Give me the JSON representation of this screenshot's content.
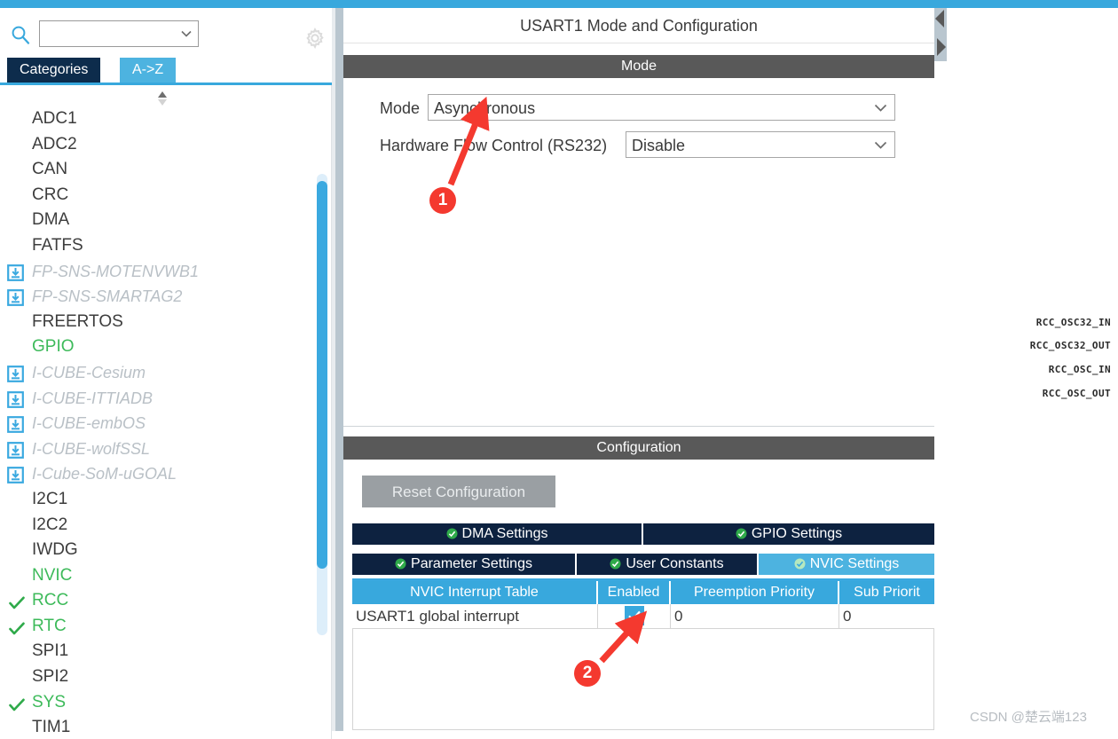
{
  "app": {
    "watermark": "CSDN @楚云端123"
  },
  "sidebar": {
    "search": {
      "value": "",
      "placeholder": ""
    },
    "tabs": [
      {
        "label": "Categories",
        "active": false
      },
      {
        "label": "A->Z",
        "active": true
      }
    ],
    "gear_tooltip": "Settings",
    "items": [
      {
        "label": "ADC1",
        "state": "normal"
      },
      {
        "label": "ADC2",
        "state": "normal"
      },
      {
        "label": "CAN",
        "state": "normal"
      },
      {
        "label": "CRC",
        "state": "normal"
      },
      {
        "label": "DMA",
        "state": "normal"
      },
      {
        "label": "FATFS",
        "state": "normal"
      },
      {
        "label": "FP-SNS-MOTENVWB1",
        "state": "download"
      },
      {
        "label": "FP-SNS-SMARTAG2",
        "state": "download"
      },
      {
        "label": "FREERTOS",
        "state": "normal"
      },
      {
        "label": "GPIO",
        "state": "configured"
      },
      {
        "label": "I-CUBE-Cesium",
        "state": "download"
      },
      {
        "label": "I-CUBE-ITTIADB",
        "state": "download"
      },
      {
        "label": "I-CUBE-embOS",
        "state": "download"
      },
      {
        "label": "I-CUBE-wolfSSL",
        "state": "download"
      },
      {
        "label": "I-Cube-SoM-uGOAL",
        "state": "download"
      },
      {
        "label": "I2C1",
        "state": "normal"
      },
      {
        "label": "I2C2",
        "state": "normal"
      },
      {
        "label": "IWDG",
        "state": "normal"
      },
      {
        "label": "NVIC",
        "state": "configured"
      },
      {
        "label": "RCC",
        "state": "checked"
      },
      {
        "label": "RTC",
        "state": "checked"
      },
      {
        "label": "SPI1",
        "state": "normal"
      },
      {
        "label": "SPI2",
        "state": "normal"
      },
      {
        "label": "SYS",
        "state": "checked"
      },
      {
        "label": "TIM1",
        "state": "normal"
      }
    ]
  },
  "main": {
    "title": "USART1 Mode and Configuration",
    "mode_section": {
      "header": "Mode",
      "fields": [
        {
          "label": "Mode",
          "value": "Asynchronous"
        },
        {
          "label": "Hardware Flow Control (RS232)",
          "value": "Disable"
        }
      ]
    },
    "configuration_section": {
      "header": "Configuration",
      "reset_label": "Reset Configuration",
      "tabs_row1": [
        {
          "label": "DMA Settings",
          "active": false
        },
        {
          "label": "GPIO Settings",
          "active": false
        }
      ],
      "tabs_row2": [
        {
          "label": "Parameter Settings",
          "active": false
        },
        {
          "label": "User Constants",
          "active": false
        },
        {
          "label": "NVIC Settings",
          "active": true
        }
      ],
      "table": {
        "columns": [
          "NVIC Interrupt Table",
          "Enabled",
          "Preemption Priority",
          "Sub Priorit"
        ],
        "rows": [
          {
            "name": "USART1 global interrupt",
            "enabled": true,
            "preemption_priority": "0",
            "sub_priority": "0"
          }
        ]
      }
    }
  },
  "right_pane": {
    "pin_labels": [
      "RCC_OSC32_IN",
      "RCC_OSC32_OUT",
      "RCC_OSC_IN",
      "RCC_OSC_OUT"
    ]
  },
  "annotations": [
    {
      "number": "1",
      "target": "mode-combo"
    },
    {
      "number": "2",
      "target": "nvic-enabled-checkbox"
    }
  ],
  "colors": {
    "accent_blue": "#38a8dd",
    "tab_navy": "#0d2240",
    "section_gray": "#595959",
    "configured_green": "#3dba5a",
    "annotation_red": "#f4392f"
  }
}
